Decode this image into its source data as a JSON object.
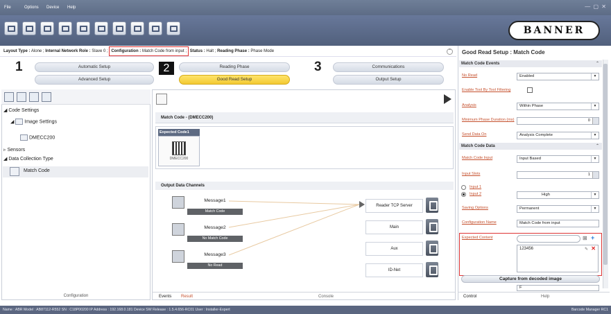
{
  "menubar": {
    "items": [
      "File",
      "Options",
      "Device",
      "Help"
    ],
    "window_controls": "— ▢ ✕"
  },
  "toolbar": {
    "logo_text": "BANNER",
    "buttons": [
      "new-icon",
      "monitor-icon",
      "sync-icon",
      "image-icon",
      "config-icon",
      "read-icon",
      "frame-icon",
      "save-icon",
      "plus-icon",
      "chart-icon"
    ]
  },
  "layout_bar": {
    "layout_type_label": "Layout Type :",
    "layout_type": "Alone ;",
    "network_role_label": "Internal Network Role :",
    "network_role": "Slave 0 ;",
    "configuration_label": "Configuration :",
    "configuration": "Match Code from input ;",
    "status_label": "Status :",
    "status": "Halt ;",
    "reading_phase_label": "Reading Phase :",
    "reading_phase": "Phase Mode"
  },
  "steps": {
    "step1": {
      "num": "1",
      "buttons": [
        "Automatic Setup",
        "Advanced Setup"
      ]
    },
    "step2": {
      "num": "2",
      "buttons": [
        "Reading Phase",
        "Good Read Setup"
      ]
    },
    "step3": {
      "num": "3",
      "buttons": [
        "Communications",
        "Output Setup"
      ]
    }
  },
  "left_panel": {
    "tree": [
      "Code Settings",
      "Image Settings",
      "DMECC200",
      "Sensors",
      "Data Collection Type",
      "Match Code"
    ],
    "footer": "Configuration"
  },
  "center_panel": {
    "match_code_header": "Match Code - (DMECC200)",
    "expected_code_tab": "Expected Code1",
    "expected_code_caption": "DMECC200",
    "output_header": "Output Data Channels",
    "messages": [
      {
        "name": "Message1",
        "status": "Match Code"
      },
      {
        "name": "Message2",
        "status": "No Match Code"
      },
      {
        "name": "Message3",
        "status": "No Read"
      }
    ],
    "outputs": [
      "Reader TCP Server",
      "Main",
      "Aux",
      "ID-Net"
    ],
    "footer_tabs": [
      "Events",
      "Result"
    ],
    "footer_center": "Console"
  },
  "right_panel": {
    "title": "Good Read Setup : Match Code",
    "section_events": "Match Code Events",
    "no_read_label": "No Read",
    "no_read_value": "Enabled",
    "enable_tool_label": "Enable Tool By Tool Filtering",
    "analysis_label": "Analysis",
    "analysis_value": "Within Phase",
    "min_phase_label": "Minimum Phase Duration (ms)",
    "min_phase_value": "0",
    "send_data_label": "Send Data On",
    "send_data_value": "Analysis Complete",
    "section_data": "Match Code Data",
    "mc_input_label": "Match Code Input",
    "mc_input_value": "Input Based",
    "input_slots_label": "Input Slots",
    "input_slots_value": "1",
    "input1_label": "Input 1",
    "input2_label": "Input 2",
    "input2_value": "High",
    "saving_label": "Saving Options",
    "saving_value": "Permanent",
    "config_name_label": "Configuration Name",
    "config_name_value": "Match Code from input",
    "expected_content_label": "Expected Content",
    "expected_content_value": "123456",
    "capture_button": "Capture from decoded image",
    "bottom_field": "F",
    "footer_tabs": [
      "Control",
      "Help"
    ]
  },
  "status_bar": {
    "left": "Name : ABR  Model : AB87112-R552  SN : C18P00200  IP Address : 192.168.0.181  Device SW Release : 1.5.4.656-RC01  User : Installer-Expert",
    "right": "Barcode Manager RC1"
  }
}
